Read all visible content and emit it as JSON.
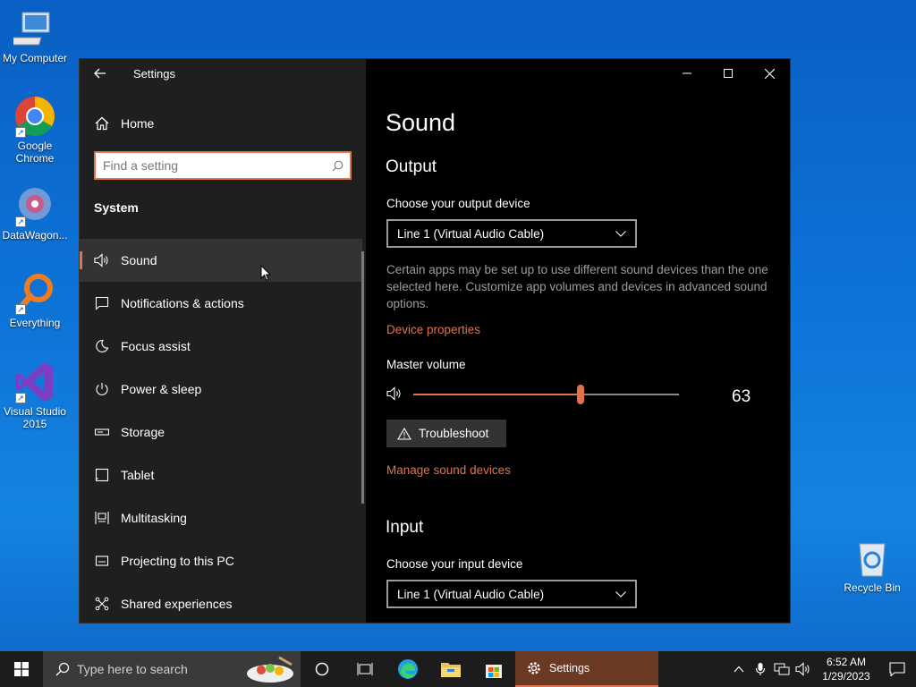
{
  "desktop": {
    "icons": [
      {
        "label": "My Computer",
        "icon": "computer-icon"
      },
      {
        "label": "Google Chrome",
        "icon": "chrome-icon"
      },
      {
        "label": "DataWagon...",
        "icon": "datawagon-icon"
      },
      {
        "label": "Everything",
        "icon": "everything-search-icon"
      },
      {
        "label": "Visual Studio 2015",
        "icon": "visual-studio-icon"
      },
      {
        "label": "Recycle Bin",
        "icon": "recycle-bin-icon"
      }
    ]
  },
  "window": {
    "title": "Settings",
    "nav": {
      "home_label": "Home",
      "search_placeholder": "Find a setting",
      "section_title": "System",
      "items": [
        {
          "label": "Sound",
          "icon": "speaker-icon",
          "active": true
        },
        {
          "label": "Notifications & actions",
          "icon": "notification-icon"
        },
        {
          "label": "Focus assist",
          "icon": "moon-icon"
        },
        {
          "label": "Power & sleep",
          "icon": "power-icon"
        },
        {
          "label": "Storage",
          "icon": "storage-icon"
        },
        {
          "label": "Tablet",
          "icon": "tablet-icon"
        },
        {
          "label": "Multitasking",
          "icon": "multitasking-icon"
        },
        {
          "label": "Projecting to this PC",
          "icon": "projector-icon"
        },
        {
          "label": "Shared experiences",
          "icon": "shared-icon"
        }
      ]
    },
    "content": {
      "page_title": "Sound",
      "output_heading": "Output",
      "output_device_label": "Choose your output device",
      "output_device_value": "Line 1 (Virtual Audio Cable)",
      "description": "Certain apps may be set up to use different sound devices than the one selected here. Customize app volumes and devices in advanced sound options.",
      "device_properties_link": "Device properties",
      "master_volume_label": "Master volume",
      "master_volume_value": "63",
      "master_volume_level": 0.63,
      "troubleshoot_label": "Troubleshoot",
      "manage_devices_link": "Manage sound devices",
      "input_heading": "Input",
      "input_device_label": "Choose your input device",
      "input_device_value": "Line 1 (Virtual Audio Cable)"
    }
  },
  "taskbar": {
    "search_placeholder": "Type here to search",
    "active_app_label": "Settings",
    "time": "6:52 AM",
    "date": "1/29/2023"
  },
  "colors": {
    "accent": "#e0734b"
  }
}
